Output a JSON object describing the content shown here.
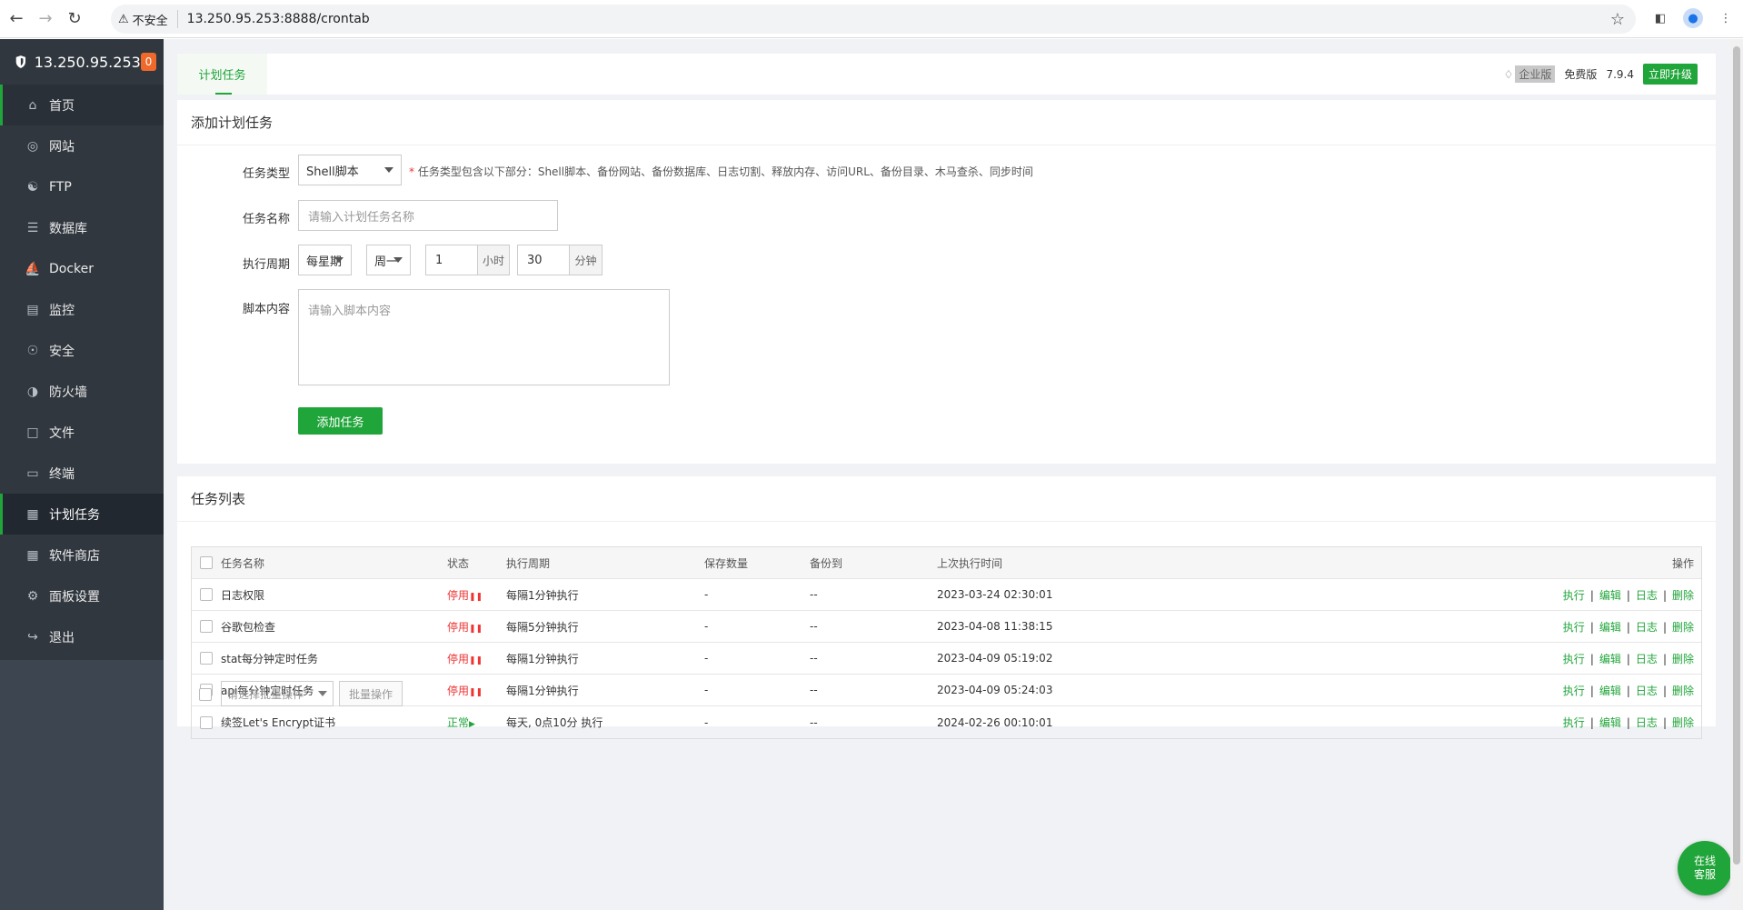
{
  "browser": {
    "security_label": "不安全",
    "url": "13.250.95.253:8888/crontab"
  },
  "sidebar": {
    "server_ip": "13.250.95.253",
    "alert_count": "0",
    "items": [
      {
        "label": "首页",
        "icon": "home-icon"
      },
      {
        "label": "网站",
        "icon": "globe-icon"
      },
      {
        "label": "FTP",
        "icon": "ftp-icon"
      },
      {
        "label": "数据库",
        "icon": "database-icon"
      },
      {
        "label": "Docker",
        "icon": "docker-icon"
      },
      {
        "label": "监控",
        "icon": "monitor-icon"
      },
      {
        "label": "安全",
        "icon": "shield-icon"
      },
      {
        "label": "防火墙",
        "icon": "firewall-icon"
      },
      {
        "label": "文件",
        "icon": "folder-icon"
      },
      {
        "label": "终端",
        "icon": "terminal-icon"
      },
      {
        "label": "计划任务",
        "icon": "calendar-icon"
      },
      {
        "label": "软件商店",
        "icon": "grid-icon"
      },
      {
        "label": "面板设置",
        "icon": "settings-icon"
      },
      {
        "label": "退出",
        "icon": "logout-icon"
      }
    ]
  },
  "topbar": {
    "tab": "计划任务",
    "enterprise": "企业版",
    "free": "免费版",
    "version": "7.9.4",
    "upgrade": "立即升级"
  },
  "add_task": {
    "title": "添加计划任务",
    "type_label": "任务类型",
    "type_value": "Shell脚本",
    "type_hint_mark": "*",
    "type_hint": "任务类型包含以下部分：Shell脚本、备份网站、备份数据库、日志切割、释放内存、访问URL、备份目录、木马查杀、同步时间",
    "name_label": "任务名称",
    "name_placeholder": "请输入计划任务名称",
    "cycle_label": "执行周期",
    "cycle_value": "每星期",
    "weekday_value": "周一",
    "hour_value": "1",
    "hour_unit": "小时",
    "minute_value": "30",
    "minute_unit": "分钟",
    "script_label": "脚本内容",
    "script_placeholder": "请输入脚本内容",
    "submit": "添加任务"
  },
  "task_list": {
    "title": "任务列表",
    "columns": [
      "任务名称",
      "状态",
      "执行周期",
      "保存数量",
      "备份到",
      "上次执行时间",
      "操作"
    ],
    "rows": [
      {
        "name": "日志权限",
        "status": "停用",
        "status_type": "off",
        "cycle": "每隔1分钟执行",
        "keep": "-",
        "backup": "--",
        "last_run": "2023-03-24 02:30:01"
      },
      {
        "name": "谷歌包检查",
        "status": "停用",
        "status_type": "off",
        "cycle": "每隔5分钟执行",
        "keep": "-",
        "backup": "--",
        "last_run": "2023-04-08 11:38:15"
      },
      {
        "name": "stat每分钟定时任务",
        "status": "停用",
        "status_type": "off",
        "cycle": "每隔1分钟执行",
        "keep": "-",
        "backup": "--",
        "last_run": "2023-04-09 05:19:02"
      },
      {
        "name": "api每分钟定时任务",
        "status": "停用",
        "status_type": "off",
        "cycle": "每隔1分钟执行",
        "keep": "-",
        "backup": "--",
        "last_run": "2023-04-09 05:24:03"
      },
      {
        "name": "续签Let's Encrypt证书",
        "status": "正常",
        "status_type": "on",
        "cycle": "每天, 0点10分 执行",
        "keep": "-",
        "backup": "--",
        "last_run": "2024-02-26 00:10:01"
      }
    ],
    "actions": [
      "执行",
      "编辑",
      "日志",
      "删除"
    ],
    "batch_placeholder": "请选择批量操作",
    "batch_button": "批量操作"
  },
  "support": {
    "line1": "在线",
    "line2": "客服"
  },
  "colors": {
    "accent": "#20a53a",
    "sidebar_bg": "#30373f",
    "danger": "#e33333"
  }
}
